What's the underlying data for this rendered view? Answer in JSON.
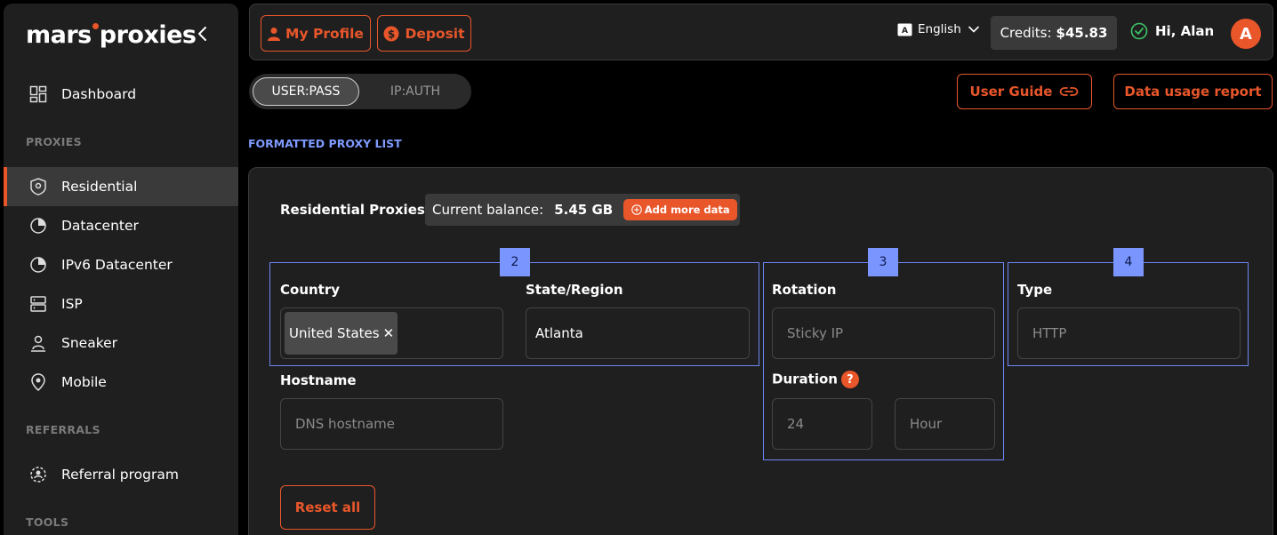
{
  "sidebar": {
    "logo": {
      "part1": "mars",
      "part2": "proxies"
    },
    "items": [
      {
        "label": "Dashboard",
        "icon": "dashboard-icon"
      },
      {
        "label": "Residential",
        "icon": "location-shield-icon",
        "active": true
      },
      {
        "label": "Datacenter",
        "icon": "pie-icon"
      },
      {
        "label": "IPv6 Datacenter",
        "icon": "pie-icon"
      },
      {
        "label": "ISP",
        "icon": "server-icon"
      },
      {
        "label": "Sneaker",
        "icon": "person-pin-icon"
      },
      {
        "label": "Mobile",
        "icon": "mobile-pin-icon"
      },
      {
        "label": "Referral program",
        "icon": "referral-icon"
      }
    ],
    "sections": {
      "proxies": "PROXIES",
      "referrals": "REFERRALS",
      "tools": "TOOLS"
    }
  },
  "topbar": {
    "my_profile": "My Profile",
    "deposit": "Deposit",
    "language": "English",
    "credits_label": "Credits:",
    "credits_value": "$45.83",
    "greeting": "Hi, Alan",
    "avatar_letter": "A"
  },
  "auth_toggle": {
    "userpass": "USER:PASS",
    "ipauth": "IP:AUTH"
  },
  "actions": {
    "user_guide": "User Guide",
    "data_usage": "Data usage report"
  },
  "formatted_label": "FORMATTED PROXY LIST",
  "card": {
    "title": "Residential Proxies",
    "balance_label": "Current balance:",
    "balance_value": "5.45 GB",
    "add_more": "Add more data",
    "markers": [
      "2",
      "3",
      "4"
    ],
    "country_label": "Country",
    "country_value": "United States",
    "state_label": "State/Region",
    "state_value": "Atlanta",
    "rotation_label": "Rotation",
    "rotation_placeholder": "Sticky IP",
    "type_label": "Type",
    "type_placeholder": "HTTP",
    "hostname_label": "Hostname",
    "hostname_placeholder": "DNS hostname",
    "duration_label": "Duration",
    "duration_help": "?",
    "duration_value": "24",
    "duration_unit": "Hour",
    "reset": "Reset all"
  },
  "colors": {
    "accent": "#e8562a",
    "highlight": "#7b95ff",
    "panel": "#1f1f1f"
  }
}
